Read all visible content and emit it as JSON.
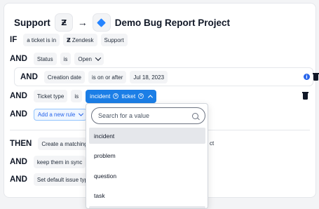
{
  "header": {
    "source": "Support",
    "target": "Demo Bug Report Project"
  },
  "rules": {
    "if_kw": "IF",
    "if_chip1": "a ticket is in",
    "if_chip2": "Zendesk",
    "if_chip3": "Support",
    "and_kw": "AND",
    "status_field": "Status",
    "status_op": "is",
    "status_val": "Open",
    "date_field": "Creation date",
    "date_op": "is on or after",
    "date_val": "Jul 18, 2023",
    "type_field": "Ticket type",
    "type_op": "is",
    "type_vals": [
      "incident",
      "ticket"
    ],
    "add_rule": "Add a new rule"
  },
  "actions": {
    "then_kw": "THEN",
    "then_chip": "Create a matching",
    "then_tail": "ct",
    "sync_chip": "keep them in sync",
    "issue_chip": "Set default issue typ"
  },
  "dropdown": {
    "placeholder": "Search for a value",
    "options": [
      "incident",
      "problem",
      "question",
      "task"
    ]
  }
}
